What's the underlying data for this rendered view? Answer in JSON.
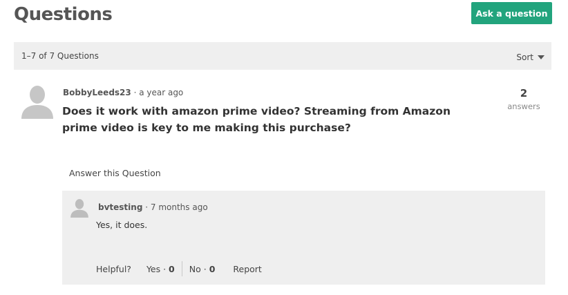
{
  "header": {
    "title": "Questions",
    "ask_button": "Ask a question",
    "accent_color": "#22a47d"
  },
  "toolbar": {
    "result_count": "1–7 of 7 Questions",
    "sort_label": "Sort"
  },
  "question": {
    "author": "BobbyLeeds23",
    "time": "· a year ago",
    "text": "Does it work with amazon prime video? Streaming from Amazon prime video is key to me making this purchase?",
    "answer_count": "2",
    "answer_count_label": "answers",
    "answer_link": "Answer this Question",
    "avatar_icon": "user-silhouette-icon"
  },
  "answer": {
    "author": "bvtesting",
    "time": "· 7 months ago",
    "text": "Yes, it does.",
    "helpful_label": "Helpful?",
    "yes_label": "Yes ·",
    "yes_count": "0",
    "no_label": "No ·",
    "no_count": "0",
    "report_label": "Report",
    "avatar_icon": "user-silhouette-icon"
  }
}
